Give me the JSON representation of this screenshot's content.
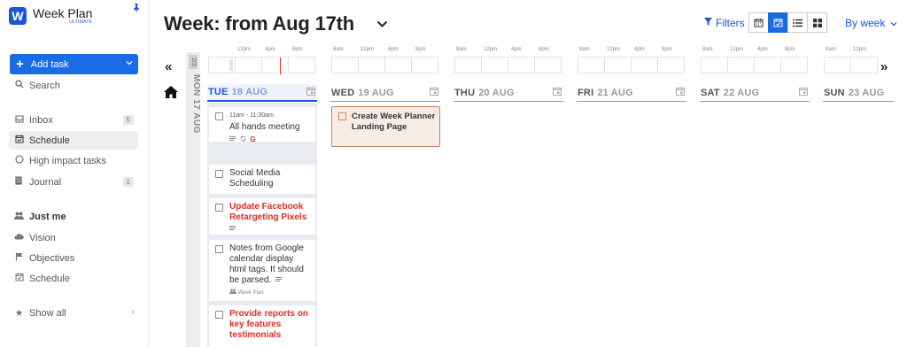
{
  "app": {
    "name": "Week Plan",
    "edition": "ULTIMATE"
  },
  "sidebar": {
    "add_task_label": "Add task",
    "search_label": "Search",
    "items": [
      {
        "label": "Inbox",
        "icon": "inbox-icon",
        "count": "5"
      },
      {
        "label": "Schedule",
        "icon": "calendar-check-icon",
        "active": true
      },
      {
        "label": "High impact tasks",
        "icon": "circle-icon"
      },
      {
        "label": "Journal",
        "icon": "book-icon",
        "count": "1"
      }
    ],
    "section_label": "Just me",
    "section_items": [
      {
        "label": "Vision",
        "icon": "cloud-icon"
      },
      {
        "label": "Objectives",
        "icon": "flag-icon"
      },
      {
        "label": "Schedule",
        "icon": "calendar-check-icon"
      }
    ],
    "show_all_label": "Show all"
  },
  "header": {
    "title": "Week: from Aug 17th",
    "filters_label": "Filters",
    "view_mode_label": "By week",
    "accent_color": "#1a6be6"
  },
  "week": {
    "side_day_label": "MON 17 AUG",
    "side_count": "2/3",
    "timeline_labels": [
      "8am",
      "12pm",
      "4pm",
      "8pm"
    ],
    "days": [
      {
        "name": "TUE",
        "date": "18 AUG",
        "today": true
      },
      {
        "name": "WED",
        "date": "19 AUG"
      },
      {
        "name": "THU",
        "date": "20 AUG"
      },
      {
        "name": "FRI",
        "date": "21 AUG"
      },
      {
        "name": "SAT",
        "date": "22 AUG"
      },
      {
        "name": "SUN",
        "date": "23 AUG"
      }
    ]
  },
  "tasks": {
    "tue": [
      {
        "time": "11am - 11:30am",
        "title": "All hands meeting",
        "meta_g": "G"
      },
      {
        "title": "Social Media Scheduling"
      },
      {
        "title": "Update Facebook Retargeting Pixels",
        "priority": true
      },
      {
        "title": "Notes from Google calendar display html tags. It should be parsed.",
        "meta": "Week Plan"
      },
      {
        "title": "Provide reports on key features testimonials",
        "priority": true
      }
    ],
    "wed": [
      {
        "title": "Create Week Planner Landing Page"
      }
    ]
  }
}
